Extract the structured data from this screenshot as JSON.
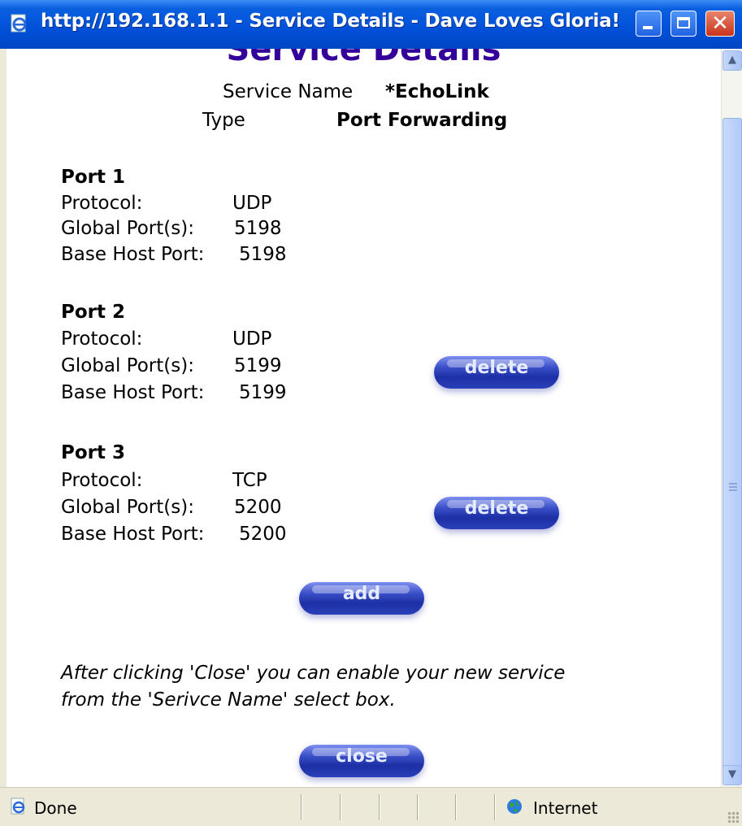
{
  "window": {
    "title": "http://192.168.1.1 - Service Details - Dave Loves Gloria!",
    "controls": [
      "minimize",
      "maximize",
      "close"
    ]
  },
  "page": {
    "heading": "Service Details",
    "service_name_label": "Service Name",
    "service_name_value": "*EchoLink",
    "type_label": "Type",
    "type_value": "Port Forwarding",
    "field_labels": {
      "protocol": "Protocol:",
      "global_ports": "Global Port(s):",
      "base_host_port": "Base Host Port:"
    },
    "ports": [
      {
        "title": "Port 1",
        "protocol": "UDP",
        "global_ports": "5198",
        "base_host_port": "5198",
        "deletable": false
      },
      {
        "title": "Port 2",
        "protocol": "UDP",
        "global_ports": "5199",
        "base_host_port": "5199",
        "deletable": true,
        "delete_label": "delete"
      },
      {
        "title": "Port 3",
        "protocol": "TCP",
        "global_ports": "5200",
        "base_host_port": "5200",
        "deletable": true,
        "delete_label": "delete"
      }
    ],
    "add_label": "add",
    "note_line1": "After clicking 'Close' you can enable your new service",
    "note_line2": "from the 'Serivce Name' select box.",
    "close_label": "close"
  },
  "statusbar": {
    "status": "Done",
    "zone": "Internet"
  },
  "colors": {
    "heading": "#330099",
    "titlebar": "#0050d8",
    "button": "#1c2fa5"
  }
}
